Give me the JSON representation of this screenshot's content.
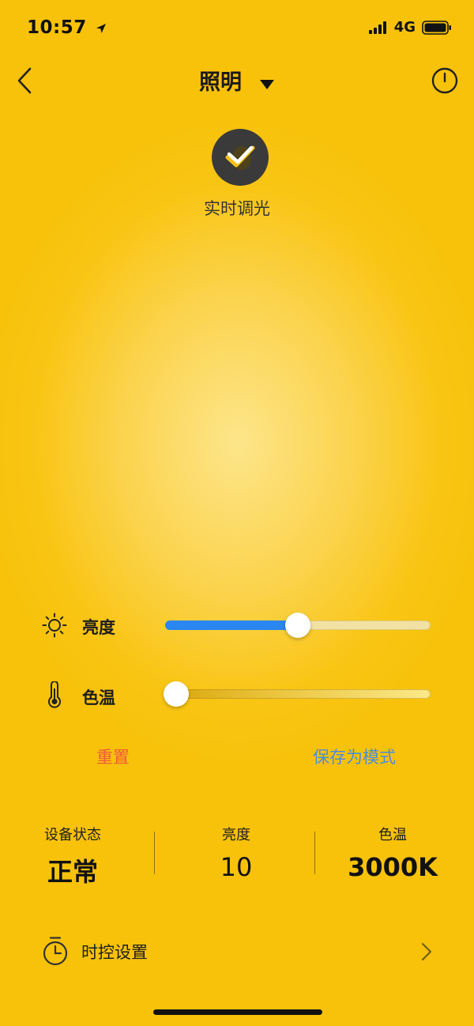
{
  "status_bar": {
    "time": "10:57",
    "network": "4G"
  },
  "nav": {
    "title": "照明"
  },
  "mode": {
    "label": "实时调光",
    "icon": "check-icon"
  },
  "brightness": {
    "label": "亮度",
    "level": 0.5,
    "fill_color": "#2a86f0"
  },
  "color_temp": {
    "label": "色温",
    "level": 0.0
  },
  "actions": {
    "reset": "重置",
    "save_as_mode": "保存为模式",
    "reset_color": "#f05a3c",
    "save_color": "#4b8be0"
  },
  "stats": [
    {
      "label": "设备状态",
      "value": "正常"
    },
    {
      "label": "亮度",
      "value": "10"
    },
    {
      "label": "色温",
      "value": "3000K"
    }
  ],
  "timer": {
    "label": "时控设置"
  }
}
